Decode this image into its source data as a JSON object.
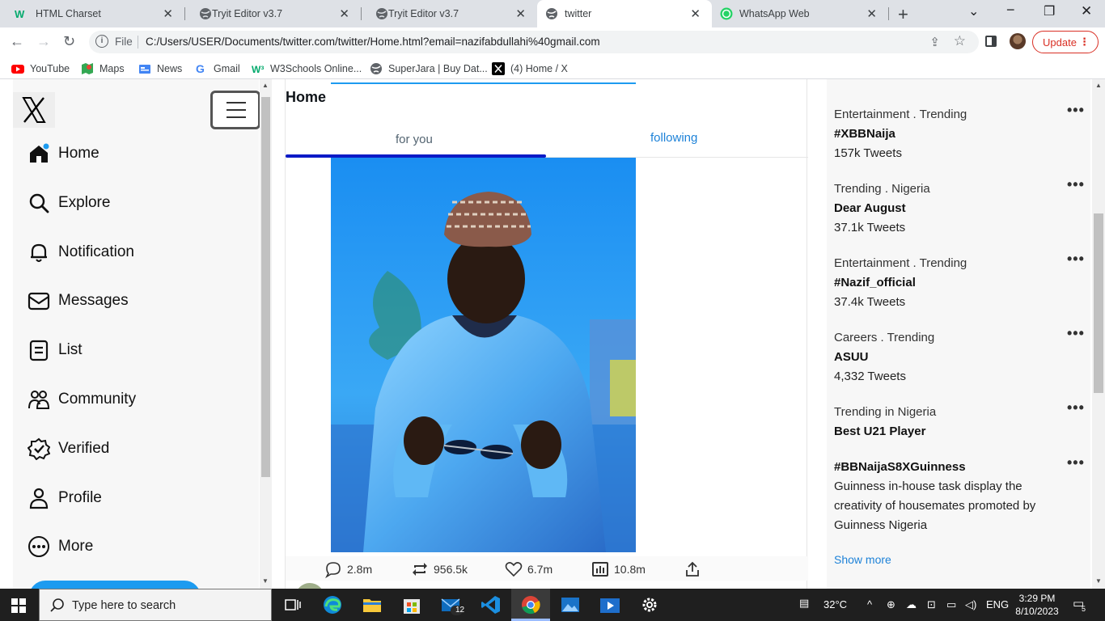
{
  "browser": {
    "tabs": [
      {
        "title": "HTML Charset",
        "icon": "w3schools-icon",
        "active": false
      },
      {
        "title": "Tryit Editor v3.7",
        "icon": "globe-icon",
        "active": false
      },
      {
        "title": "Tryit Editor v3.7",
        "icon": "globe-icon",
        "active": false
      },
      {
        "title": "twitter",
        "icon": "globe-icon",
        "active": true
      },
      {
        "title": "WhatsApp Web",
        "icon": "whatsapp-icon",
        "active": false
      }
    ],
    "address": {
      "scheme_label": "File",
      "url": "C:/Users/USER/Documents/twitter.com/twitter/Home.html?email=nazifabdullahi%40gmail.com"
    },
    "update_label": "Update",
    "bookmarks": [
      {
        "label": "YouTube",
        "icon": "youtube-icon"
      },
      {
        "label": "Maps",
        "icon": "maps-icon"
      },
      {
        "label": "News",
        "icon": "news-icon"
      },
      {
        "label": "Gmail",
        "icon": "google-icon"
      },
      {
        "label": "W3Schools Online...",
        "icon": "w3schools-icon"
      },
      {
        "label": "SuperJara | Buy Dat...",
        "icon": "globe-icon"
      },
      {
        "label": "(4) Home / X",
        "icon": "x-icon"
      }
    ]
  },
  "sidebar": {
    "items": [
      {
        "label": "Home",
        "icon": "home-icon"
      },
      {
        "label": "Explore",
        "icon": "search-icon"
      },
      {
        "label": "Notification",
        "icon": "bell-icon"
      },
      {
        "label": "Messages",
        "icon": "mail-icon"
      },
      {
        "label": "List",
        "icon": "list-icon"
      },
      {
        "label": "Community",
        "icon": "community-icon"
      },
      {
        "label": "Verified",
        "icon": "verified-icon"
      },
      {
        "label": "Profile",
        "icon": "person-icon"
      },
      {
        "label": "More",
        "icon": "more-circle-icon"
      }
    ]
  },
  "feed": {
    "title": "Home",
    "tabs": {
      "for_you": "for you",
      "following": "following"
    },
    "actions": {
      "replies": "2.8m",
      "retweets": "956.5k",
      "likes": "6.7m",
      "views": "10.8m"
    }
  },
  "trends": {
    "items": [
      {
        "category": "Entertainment . Trending",
        "name": "#XBBNaija",
        "count": "157k Tweets"
      },
      {
        "category": "Trending . Nigeria",
        "name": "Dear August",
        "count": "37.1k Tweets"
      },
      {
        "category": "Entertainment . Trending",
        "name": "#Nazif_official",
        "count": "37.4k Tweets"
      },
      {
        "category": "Careers . Trending",
        "name": "ASUU",
        "count": "4,332 Tweets"
      },
      {
        "category": "Trending in Nigeria",
        "name": "Best U21 Player",
        "count": ""
      }
    ],
    "promoted": {
      "name": "#BBNaijaS8XGuinness",
      "line1": "Guinness in-house task display the",
      "line2": "creativity of housemates promoted by",
      "line3": "Guinness Nigeria"
    },
    "more_glyph": "•••",
    "show_more": "Show more"
  },
  "taskbar": {
    "search_placeholder": "Type here to search",
    "weather": "32°C",
    "language": "ENG",
    "time": "3:29 PM",
    "date": "8/10/2023",
    "mail_badge": "12",
    "notif_count": "5"
  },
  "colors": {
    "accent": "#1d9bf0",
    "tab_underline": "#0b1ac6",
    "update": "#d93025"
  }
}
